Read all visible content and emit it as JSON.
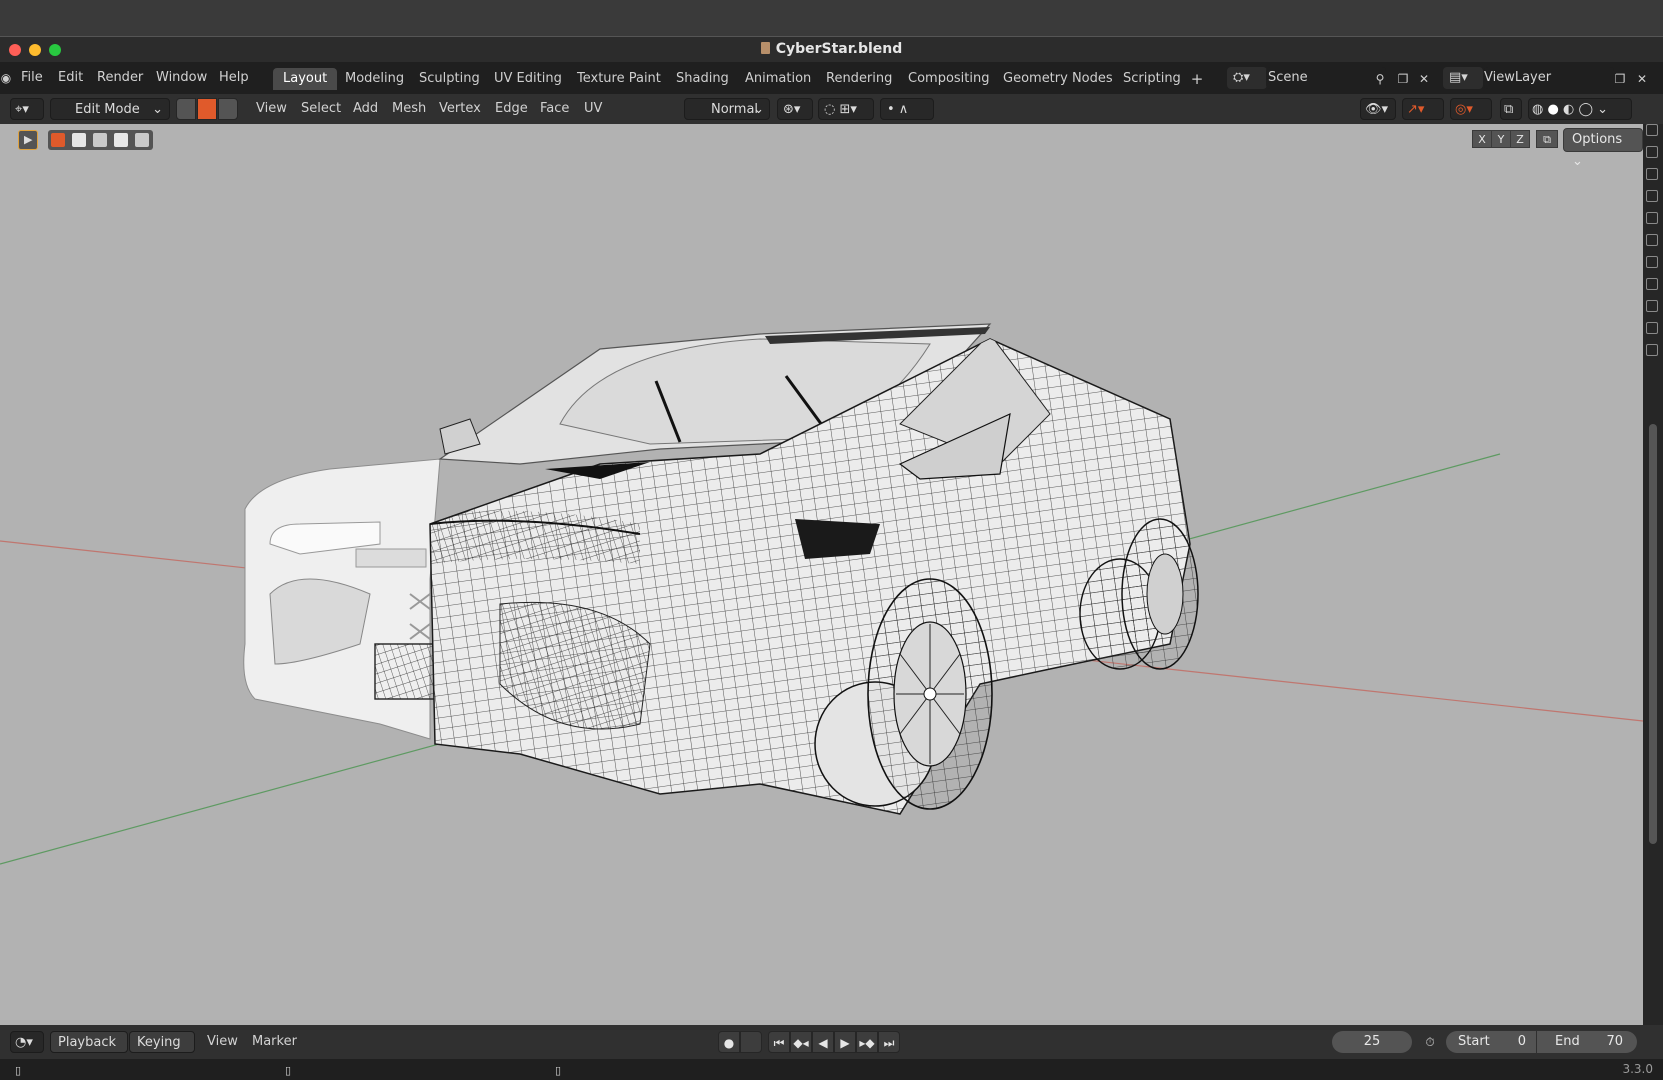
{
  "window": {
    "title": "CyberStar.blend",
    "close_color": "#fe5f57",
    "minimize_color": "#febc2e",
    "maximize_color": "#28c840"
  },
  "topbar": {
    "menus": [
      "File",
      "Edit",
      "Render",
      "Window",
      "Help"
    ],
    "workspaces": [
      "Layout",
      "Modeling",
      "Sculpting",
      "UV Editing",
      "Texture Paint",
      "Shading",
      "Animation",
      "Rendering",
      "Compositing",
      "Geometry Nodes",
      "Scripting"
    ],
    "active_workspace": "Layout",
    "add_workspace": "+",
    "scene_name": "Scene",
    "view_layer": "ViewLayer"
  },
  "viewport_header": {
    "mode": "Edit Mode",
    "menus": [
      "View",
      "Select",
      "Add",
      "Mesh",
      "Vertex",
      "Edge",
      "Face",
      "UV"
    ],
    "transform_orientation": "Normal",
    "select_mode_active": "edge",
    "accent": "#e05a2b"
  },
  "viewport": {
    "axes": [
      "X",
      "Y",
      "Z"
    ],
    "options_label": "Options",
    "background": "#b2b2b2",
    "x_axis_color": "#c0766f",
    "y_axis_color": "#5e9a62"
  },
  "timeline": {
    "menus": {
      "playback": "Playback",
      "keying": "Keying",
      "view": "View",
      "marker": "Marker"
    },
    "current_frame": "25",
    "start_label": "Start",
    "start": "0",
    "end_label": "End",
    "end": "70"
  },
  "status": {
    "version": "3.3.0"
  }
}
